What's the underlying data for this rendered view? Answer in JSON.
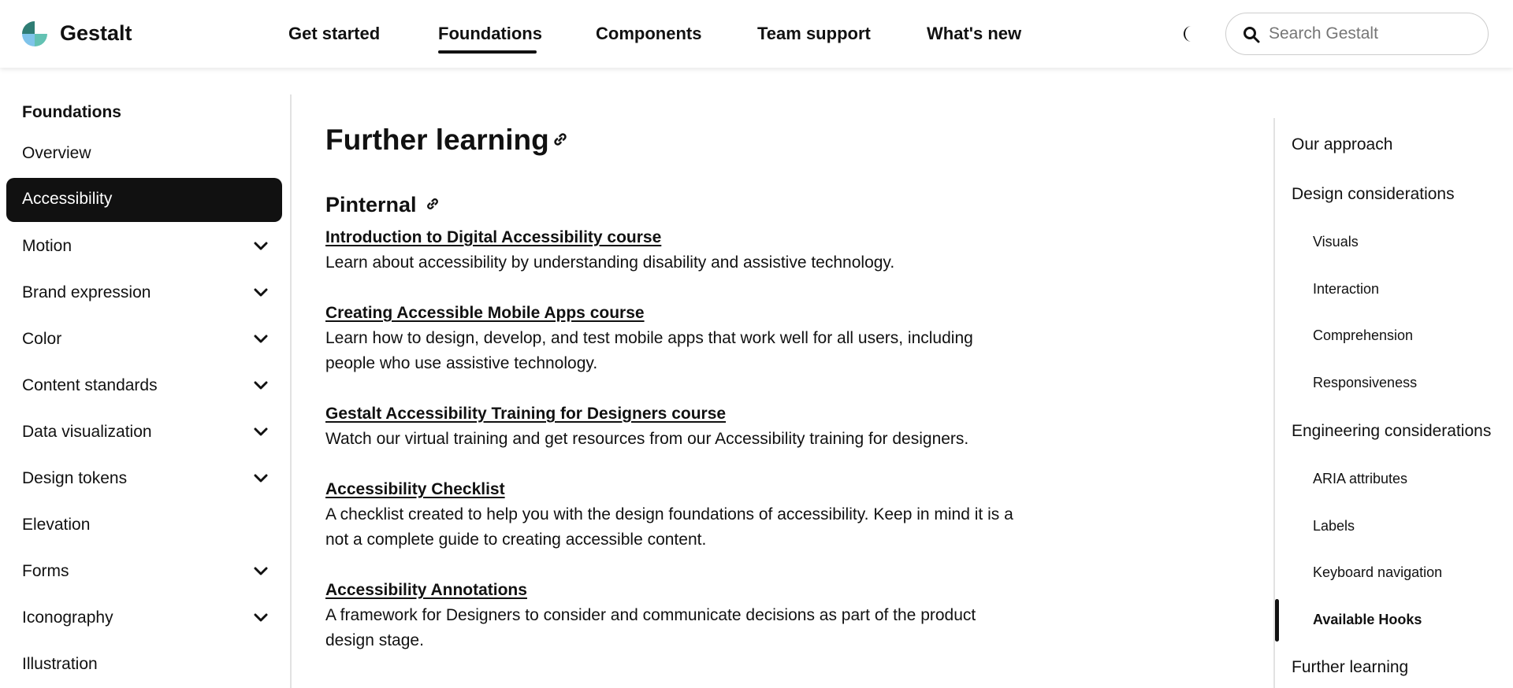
{
  "header": {
    "brand": "Gestalt",
    "nav": [
      {
        "label": "Get started"
      },
      {
        "label": "Foundations"
      },
      {
        "label": "Components"
      },
      {
        "label": "Team support"
      },
      {
        "label": "What's new"
      }
    ],
    "active_nav": "Foundations",
    "search_placeholder": "Search Gestalt",
    "icons": {
      "logo": "gestalt-logo",
      "theme": "moon-icon",
      "search": "search-icon"
    }
  },
  "sidebar": {
    "heading": "Foundations",
    "items": [
      {
        "label": "Overview",
        "expandable": false
      },
      {
        "label": "Accessibility",
        "expandable": false,
        "active": true
      },
      {
        "label": "Motion",
        "expandable": true
      },
      {
        "label": "Brand expression",
        "expandable": true
      },
      {
        "label": "Color",
        "expandable": true
      },
      {
        "label": "Content standards",
        "expandable": true
      },
      {
        "label": "Data visualization",
        "expandable": true
      },
      {
        "label": "Design tokens",
        "expandable": true
      },
      {
        "label": "Elevation",
        "expandable": false
      },
      {
        "label": "Forms",
        "expandable": true
      },
      {
        "label": "Iconography",
        "expandable": true
      },
      {
        "label": "Illustration",
        "expandable": false
      }
    ]
  },
  "main": {
    "title": "Further learning",
    "section": "Pinternal",
    "resources": [
      {
        "link": "Introduction to Digital Accessibility course",
        "description": "Learn about accessibility by understanding disability and assistive technology."
      },
      {
        "link": "Creating Accessible Mobile Apps course",
        "description": "Learn how to design, develop, and test mobile apps that work well for all users, including people who use assistive technology."
      },
      {
        "link": "Gestalt Accessibility Training for Designers course",
        "description": "Watch our virtual training and get resources from our Accessibility training for designers."
      },
      {
        "link": "Accessibility Checklist",
        "description": "A checklist created to help you with the design foundations of accessibility. Keep in mind it is a not a complete guide to creating accessible content."
      },
      {
        "link": "Accessibility Annotations",
        "description": "A framework for Designers to consider and communicate decisions as part of the product design stage."
      }
    ]
  },
  "toc": {
    "items": [
      {
        "label": "Our approach",
        "level": 1
      },
      {
        "label": "Design considerations",
        "level": 1
      },
      {
        "label": "Visuals",
        "level": 2
      },
      {
        "label": "Interaction",
        "level": 2
      },
      {
        "label": "Comprehension",
        "level": 2
      },
      {
        "label": "Responsiveness",
        "level": 2
      },
      {
        "label": "Engineering considerations",
        "level": 1
      },
      {
        "label": "ARIA attributes",
        "level": 2
      },
      {
        "label": "Labels",
        "level": 2
      },
      {
        "label": "Keyboard navigation",
        "level": 2
      },
      {
        "label": "Available Hooks",
        "level": 2,
        "active": true
      },
      {
        "label": "Further learning",
        "level": 1
      }
    ]
  },
  "colors": {
    "text": "#111111",
    "active_bg": "#111111",
    "divider": "#e2e2e2",
    "logo_teal": "#3a9e98",
    "logo_blue": "#5aa6e0"
  }
}
